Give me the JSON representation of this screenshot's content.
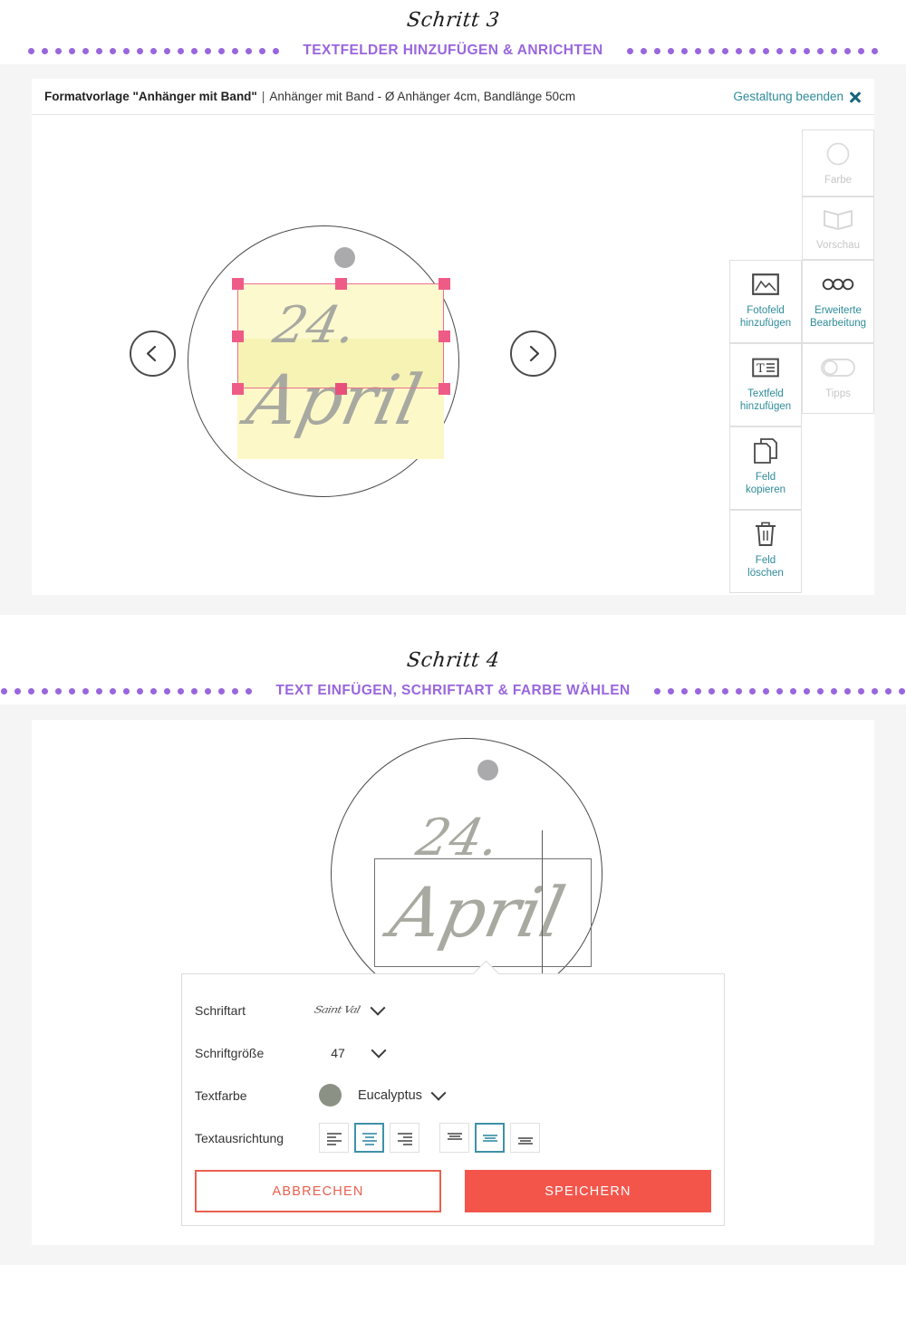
{
  "theme": {
    "accent_purple": "#9966DD",
    "teal": "#2E8B9A",
    "red": "#f4554b",
    "eucalyptus": "#8b9184",
    "handle_pink": "#ef5b87",
    "field_yellow": "#fcf8c8"
  },
  "step3": {
    "script_label": "Schritt 3",
    "title": "TEXTFELDER HINZUFÜGEN & ANRICHTEN",
    "editor": {
      "format_label": "Formatvorlage \"Anhänger mit Band\"",
      "separator": "|",
      "format_description": "Anhänger mit Band - Ø Anhänger 4cm, Bandlänge 50cm",
      "end_design": "Gestaltung beenden",
      "close_icon": "close-x-icon"
    },
    "canvas": {
      "pendant_text_line1": "24.",
      "pendant_text_line2": "April",
      "prev_arrow_icon": "chevron-left-icon",
      "next_arrow_icon": "chevron-right-icon"
    },
    "tools": [
      {
        "label": "Fotofeld\nhinzufügen",
        "label_l1": "Fotofeld",
        "label_l2": "hinzufügen",
        "icon": "image-icon",
        "enabled": true
      },
      {
        "label": "Erweiterte\nBearbeitung",
        "label_l1": "Erweiterte",
        "label_l2": "Bearbeitung",
        "icon": "three-circles-icon",
        "enabled": true
      },
      {
        "label": "Textfeld\nhinzufügen",
        "label_l1": "Textfeld",
        "label_l2": "hinzufügen",
        "icon": "text-field-icon",
        "enabled": true
      },
      {
        "label": "Feld\nkopieren",
        "label_l1": "Feld",
        "label_l2": "kopieren",
        "icon": "copy-icon",
        "enabled": true
      },
      {
        "label": "Feld\nlöschen",
        "label_l1": "Feld",
        "label_l2": "löschen",
        "icon": "trash-icon",
        "enabled": true
      },
      {
        "label": "Farbe",
        "label_l1": "Farbe",
        "label_l2": "",
        "icon": "color-circle-icon",
        "enabled": false
      },
      {
        "label": "Vorschau",
        "label_l1": "Vorschau",
        "label_l2": "",
        "icon": "book-icon",
        "enabled": false
      },
      {
        "label": "Tipps",
        "label_l1": "Tipps",
        "label_l2": "",
        "icon": "toggle-off-icon",
        "enabled": false
      }
    ]
  },
  "step4": {
    "script_label": "Schritt 4",
    "title": "TEXT EINFÜGEN, SCHRIFTART & FARBE WÄHLEN",
    "canvas": {
      "pendant_text_line1": "24.",
      "pendant_text_line2": "April"
    },
    "settings": {
      "font_label": "Schriftart",
      "font_value": "Saint Val",
      "size_label": "Schriftgröße",
      "size_value": "47",
      "color_label": "Textfarbe",
      "color_value": "Eucalyptus",
      "color_hex": "#8b9184",
      "align_label": "Textausrichtung",
      "align_horizontal": [
        {
          "name": "align-left",
          "selected": false
        },
        {
          "name": "align-center",
          "selected": true
        },
        {
          "name": "align-right",
          "selected": false
        }
      ],
      "align_vertical": [
        {
          "name": "align-top",
          "selected": false
        },
        {
          "name": "align-middle",
          "selected": true
        },
        {
          "name": "align-bottom",
          "selected": false
        }
      ],
      "cancel_label": "ABBRECHEN",
      "save_label": "SPEICHERN"
    }
  }
}
